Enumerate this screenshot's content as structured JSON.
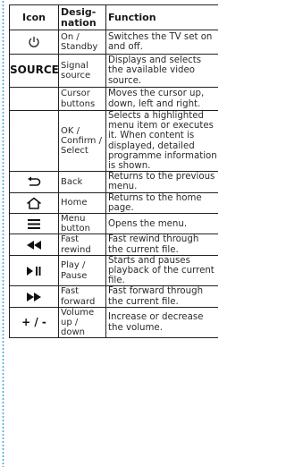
{
  "headers": {
    "icon": "Icon",
    "designation": "Desig-\nnation",
    "function": "Function"
  },
  "rows": [
    {
      "icon_name": "power-icon",
      "icon_text": "",
      "designation": [
        "On /",
        "Standby"
      ],
      "function": [
        "Switches the TV set on",
        "and off."
      ]
    },
    {
      "icon_name": "source-label",
      "icon_text": "SOURCE",
      "designation": [
        "Signal",
        "source"
      ],
      "function": [
        "Displays and selects",
        "the available video",
        "source."
      ]
    },
    {
      "icon_name": "cursor-buttons-icon",
      "icon_text": "",
      "designation": [
        "Cursor",
        "buttons"
      ],
      "function": [
        "Moves the cursor up,",
        "down, left and right."
      ]
    },
    {
      "icon_name": "ok-icon",
      "icon_text": "",
      "designation": [
        "OK /",
        "Confirm /",
        "Select"
      ],
      "function": [
        "Selects a highlighted",
        "menu item or executes",
        "it. When content is",
        "displayed, detailed",
        "programme information",
        "is shown."
      ]
    },
    {
      "icon_name": "back-arrow-icon",
      "icon_text": "",
      "designation": [
        "Back"
      ],
      "function": [
        "Returns to the previous",
        "menu."
      ]
    },
    {
      "icon_name": "home-icon",
      "icon_text": "",
      "designation": [
        "Home"
      ],
      "function": [
        "Returns to the home",
        "page."
      ]
    },
    {
      "icon_name": "menu-icon",
      "icon_text": "",
      "designation": [
        "Menu",
        "button"
      ],
      "function": [
        "Opens the menu."
      ]
    },
    {
      "icon_name": "fast-rewind-icon",
      "icon_text": "",
      "designation": [
        "Fast",
        "rewind"
      ],
      "function": [
        "Fast rewind through",
        "the current file."
      ]
    },
    {
      "icon_name": "play-pause-icon",
      "icon_text": "",
      "designation": [
        "Play /",
        "Pause"
      ],
      "function": [
        "Starts and pauses",
        "playback of the current",
        "file."
      ]
    },
    {
      "icon_name": "fast-forward-icon",
      "icon_text": "",
      "designation": [
        "Fast",
        "forward"
      ],
      "function": [
        "Fast forward through",
        "the current file."
      ]
    },
    {
      "icon_name": "volume-icon",
      "icon_text": "+ / -",
      "designation": [
        "Volume",
        "up /",
        "down"
      ],
      "function": [
        "Increase or decrease",
        "the volume."
      ]
    }
  ]
}
